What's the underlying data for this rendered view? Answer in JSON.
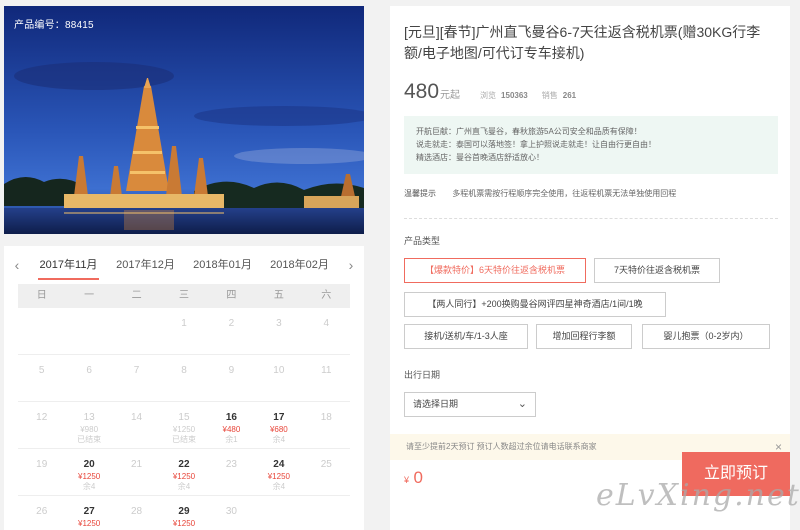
{
  "product": {
    "number_label": "产品编号：88415",
    "title": "[元旦][春节]广州直飞曼谷6-7天往返含税机票(赠30KG行李额/电子地图/可代订专车接机)",
    "price": "480",
    "price_unit": "元起",
    "views_label": "浏览",
    "views": "150363",
    "sales_label": "销售",
    "sales": "261"
  },
  "promo_lines": [
    "开航巨献：广州直飞曼谷，春秋旅游5A公司安全和品质有保障！",
    "说走就走：泰国可以落地签！拿上护照说走就走！让自由行更自由！",
    "精选酒店：曼谷首晚酒店舒适放心！"
  ],
  "tip": {
    "label": "温馨提示",
    "text": "多程机票需按行程顺序完全使用，往返程机票无法单独使用回程"
  },
  "product_type": {
    "label": "产品类型",
    "options": [
      "【爆款特价】6天特价往返含税机票",
      "7天特价往返含税机票",
      "【两人同行】+200换购曼谷网评四星神奇酒店/1间/1晚",
      "接机/送机/车/1-3人座",
      "增加回程行李额",
      "婴儿抱票（0-2岁内）"
    ],
    "selected_index": 0
  },
  "travel_date": {
    "label": "出行日期",
    "placeholder": "请选择日期"
  },
  "notice": {
    "text": "请至少提前2天预订 预订人数超过余位请电话联系商家",
    "close": "×"
  },
  "total": {
    "currency": "¥",
    "amount": "0"
  },
  "book_button": "立即预订",
  "watermark": "eLvXing.net",
  "calendar": {
    "prev": "‹",
    "next": "›",
    "months": [
      "2017年11月",
      "2017年12月",
      "2018年01月",
      "2018年02月"
    ],
    "active_month": 0,
    "weekdays": [
      "日",
      "一",
      "二",
      "三",
      "四",
      "五",
      "六"
    ],
    "cells": [
      {
        "d": "",
        "p": "",
        "s": ""
      },
      {
        "d": "",
        "p": "",
        "s": ""
      },
      {
        "d": "",
        "p": "",
        "s": ""
      },
      {
        "d": "1",
        "p": "",
        "s": ""
      },
      {
        "d": "2",
        "p": "",
        "s": ""
      },
      {
        "d": "3",
        "p": "",
        "s": ""
      },
      {
        "d": "4",
        "p": "",
        "s": ""
      },
      {
        "d": "5",
        "p": "",
        "s": ""
      },
      {
        "d": "6",
        "p": "",
        "s": ""
      },
      {
        "d": "7",
        "p": "",
        "s": ""
      },
      {
        "d": "8",
        "p": "",
        "s": ""
      },
      {
        "d": "9",
        "p": "",
        "s": ""
      },
      {
        "d": "10",
        "p": "",
        "s": ""
      },
      {
        "d": "11",
        "p": "",
        "s": ""
      },
      {
        "d": "12",
        "p": "",
        "s": ""
      },
      {
        "d": "13",
        "p": "¥980",
        "s": "已结束"
      },
      {
        "d": "14",
        "p": "",
        "s": ""
      },
      {
        "d": "15",
        "p": "¥1250",
        "s": "已结束"
      },
      {
        "d": "16",
        "p": "¥480",
        "s": "余1",
        "active": true
      },
      {
        "d": "17",
        "p": "¥680",
        "s": "余4",
        "active": true
      },
      {
        "d": "18",
        "p": "",
        "s": ""
      },
      {
        "d": "19",
        "p": "",
        "s": ""
      },
      {
        "d": "20",
        "p": "¥1250",
        "s": "余4",
        "active": true
      },
      {
        "d": "21",
        "p": "",
        "s": ""
      },
      {
        "d": "22",
        "p": "¥1250",
        "s": "余4",
        "active": true
      },
      {
        "d": "23",
        "p": "",
        "s": ""
      },
      {
        "d": "24",
        "p": "¥1250",
        "s": "余4",
        "active": true
      },
      {
        "d": "25",
        "p": "",
        "s": ""
      },
      {
        "d": "26",
        "p": "",
        "s": ""
      },
      {
        "d": "27",
        "p": "¥1250",
        "s": "",
        "active": true
      },
      {
        "d": "28",
        "p": "",
        "s": ""
      },
      {
        "d": "29",
        "p": "¥1250",
        "s": "",
        "active": true
      },
      {
        "d": "30",
        "p": "",
        "s": ""
      },
      {
        "d": "",
        "p": "",
        "s": ""
      },
      {
        "d": "",
        "p": "",
        "s": ""
      }
    ]
  },
  "colors": {
    "accent": "#ef6a5f",
    "promo_bg": "#eef7f3",
    "notice_bg": "#fdf8ea"
  }
}
